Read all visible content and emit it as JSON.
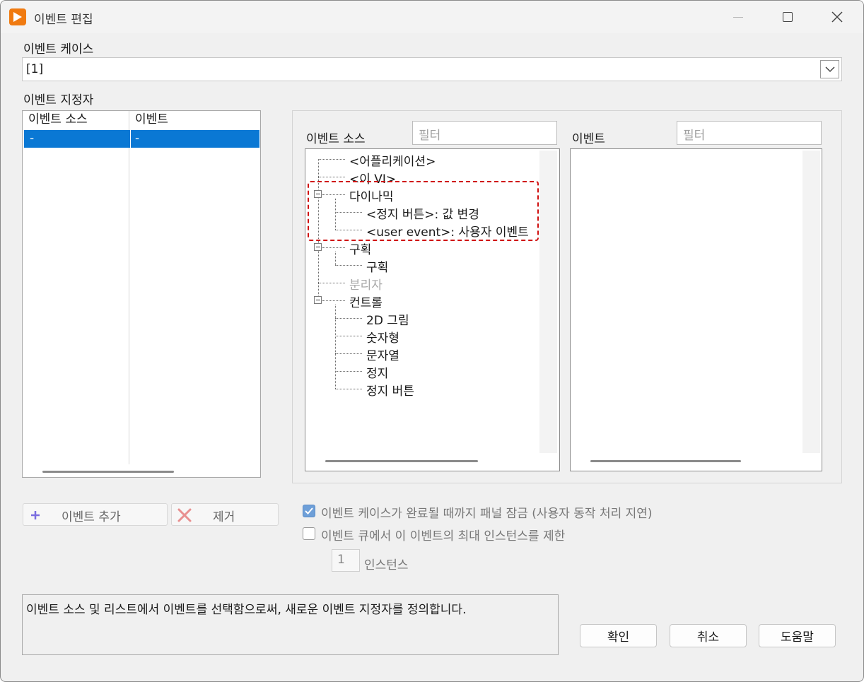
{
  "window": {
    "title": "이벤트 편집",
    "buttons": {
      "minimize": "minimize",
      "maximize": "maximize",
      "close": "close"
    }
  },
  "event_case": {
    "label": "이벤트 케이스",
    "value": "[1]"
  },
  "event_specifiers": {
    "label": "이벤트 지정자",
    "columns": [
      "이벤트 소스",
      "이벤트"
    ],
    "rows": [
      {
        "source": "-",
        "event": "-"
      }
    ]
  },
  "event_sources": {
    "label": "이벤트 소스",
    "filter_placeholder": "필터",
    "tree": {
      "app": "<어플리케이션>",
      "this_vi": "<이 VI>",
      "dynamic": "다이나믹",
      "dynamic_children": [
        "<정지 버튼>: 값 변경",
        "<user event>: 사용자 이벤트"
      ],
      "pane": "구획",
      "pane_children": [
        "구획"
      ],
      "splitter": "분리자",
      "controls": "컨트롤",
      "controls_children": [
        "2D 그림",
        "숫자형",
        "문자열",
        "정지",
        "정지 버튼"
      ]
    }
  },
  "events": {
    "label": "이벤트",
    "filter_placeholder": "필터"
  },
  "actions": {
    "add_event": "이벤트 추가",
    "remove": "제거"
  },
  "options": {
    "lock_panel": {
      "label": "이벤트 케이스가 완료될 때까지 패널 잠금 (사용자 동작 처리 지연)",
      "checked": true
    },
    "limit_instances": {
      "label": "이벤트 큐에서 이 이벤트의 최대 인스턴스를 제한",
      "checked": false
    },
    "instances_value": "1",
    "instances_label": "인스턴스"
  },
  "description": "이벤트 소스 및 리스트에서 이벤트를 선택함으로써, 새로운 이벤트 지정자를 정의합니다.",
  "footer": {
    "ok": "확인",
    "cancel": "취소",
    "help": "도움말"
  },
  "colors": {
    "selection": "#0a78d4",
    "highlight_border": "#d01010",
    "app_icon": "#f07a10",
    "checkbox_checked": "#6e9fd8"
  }
}
